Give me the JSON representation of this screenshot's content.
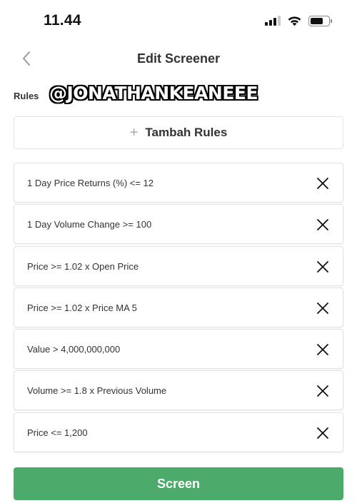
{
  "status_bar": {
    "time": "11.44",
    "signal_bars": 4,
    "signal_active": 3,
    "battery_level": 0.7
  },
  "header": {
    "title": "Edit Screener",
    "back_icon": "chevron-left-icon"
  },
  "rules_section": {
    "label": "Rules",
    "watermark": "@JONATHANKEANEEE",
    "add_button_label": "Tambah Rules",
    "add_icon": "plus-icon"
  },
  "rules": [
    {
      "text": "1 Day Price Returns (%) <= 12"
    },
    {
      "text": "1 Day Volume Change >= 100"
    },
    {
      "text": "Price >= 1.02 x Open Price"
    },
    {
      "text": "Price >= 1.02 x Price MA 5"
    },
    {
      "text": "Value > 4,000,000,000"
    },
    {
      "text": "Volume >= 1.8 x Previous Volume"
    },
    {
      "text": "Price <= 1,200"
    }
  ],
  "footer": {
    "screen_button_label": "Screen"
  },
  "colors": {
    "accent": "#4caa6b",
    "text": "#333333",
    "border": "#e2e2e2"
  }
}
